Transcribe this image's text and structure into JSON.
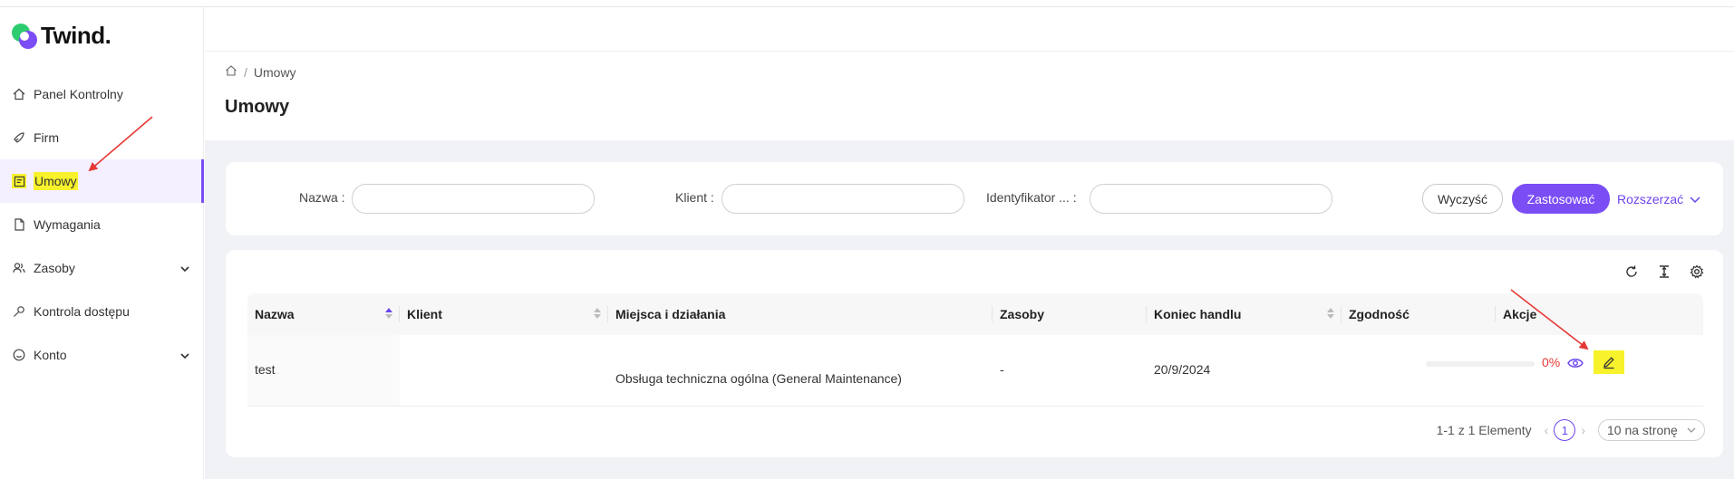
{
  "app": {
    "logo_text": "Twind."
  },
  "sidebar": {
    "items": [
      {
        "label": "Panel Kontrolny",
        "icon": "home-icon"
      },
      {
        "label": "Firm",
        "icon": "rocket-icon"
      },
      {
        "label": "Umowy",
        "icon": "contract-icon",
        "active": true
      },
      {
        "label": "Wymagania",
        "icon": "file-icon"
      },
      {
        "label": "Zasoby",
        "icon": "users-icon",
        "expandable": true
      },
      {
        "label": "Kontrola dostępu",
        "icon": "key-icon"
      },
      {
        "label": "Konto",
        "icon": "smile-icon",
        "expandable": true
      }
    ]
  },
  "breadcrumb": {
    "current": "Umowy"
  },
  "page": {
    "title": "Umowy"
  },
  "filters": {
    "name_label": "Nazwa",
    "client_label": "Klient",
    "id_label": "Identyfikator ...",
    "clear_label": "Wyczyść",
    "apply_label": "Zastosować",
    "expand_label": "Rozszerzać"
  },
  "table": {
    "columns": [
      "Nazwa",
      "Klient",
      "Miejsca i działania",
      "Zasoby",
      "Koniec handlu",
      "Zgodność",
      "Akcje"
    ],
    "rows": [
      {
        "name": "test",
        "client": "",
        "places": "Obsługa techniczna ogólna (General Maintenance)",
        "resources": "-",
        "trade_end": "20/9/2024",
        "compliance_text": "0%",
        "compliance_value": 0
      }
    ]
  },
  "pagination": {
    "summary": "1-1 z 1 Elementy",
    "current_page": "1",
    "page_size": "10 na stronę"
  },
  "colors": {
    "accent": "#7b4df5",
    "highlight": "#f7f22b",
    "annotation": "#e53935",
    "danger": "#e53935"
  }
}
